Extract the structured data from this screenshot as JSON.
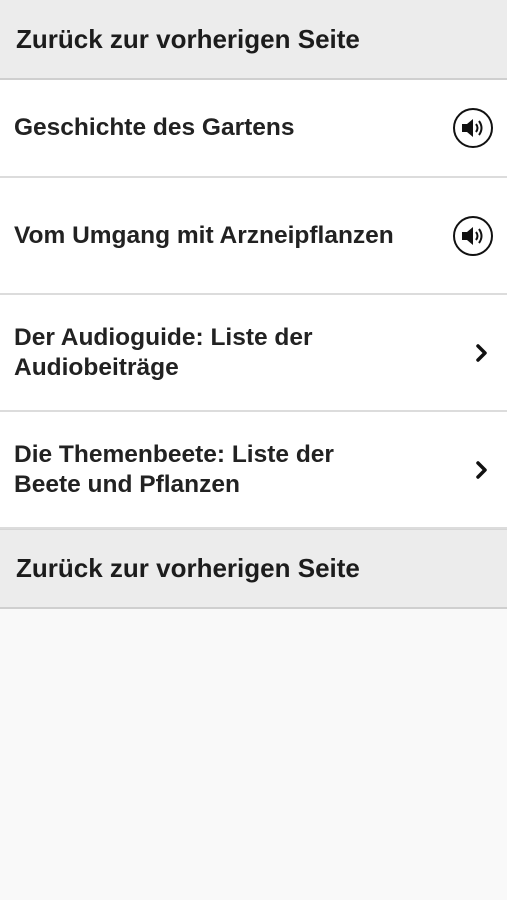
{
  "header": {
    "back_label": "Zurück zur vorherigen Seite"
  },
  "menu": {
    "items": [
      {
        "label": "Geschichte des Gartens",
        "icon": "speaker-icon"
      },
      {
        "label": "Vom Umgang mit Arzneipflanzen",
        "icon": "speaker-icon"
      },
      {
        "label": "Der Audioguide: Liste der Audiobeiträge",
        "icon": "chevron-right-icon"
      },
      {
        "label": "Die Themenbeete: Liste der Beete und Pflanzen",
        "icon": "chevron-right-icon"
      }
    ]
  },
  "footer": {
    "back_label": "Zurück zur vorherigen Seite"
  }
}
